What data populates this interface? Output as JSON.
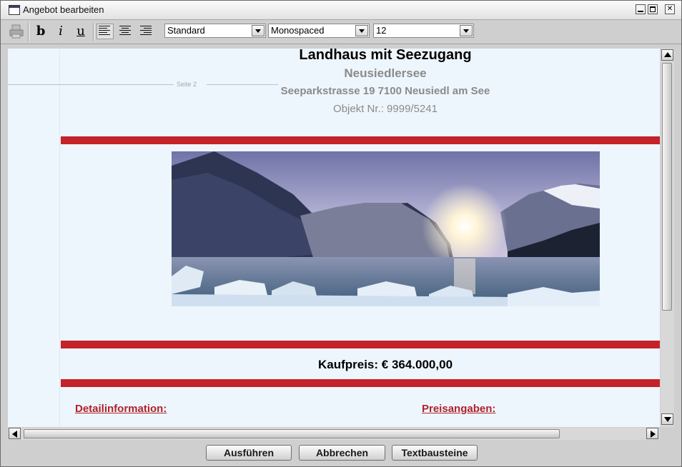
{
  "window": {
    "title": "Angebot bearbeiten"
  },
  "toolbar": {
    "print_icon": "printer-icon",
    "bold_label": "b",
    "italic_label": "i",
    "underline_label": "u",
    "style_select": "Standard",
    "font_select": "Monospaced",
    "size_select": "12"
  },
  "document": {
    "page_label": "Seite 2",
    "title": "Landhaus mit Seezugang",
    "subtitle": "Neusiedlersee",
    "address": "Seeparkstrasse 19 7100 Neusiedl am See",
    "object_number": "Objekt Nr.: 9999/5241",
    "price": "Kaufpreis: € 364.000,00",
    "section_details": "Detailinformation:",
    "section_prices": "Preisangaben: ",
    "image_subject": "mountain-lake-sunset-photo",
    "accent_color": "#c5222a"
  },
  "buttons": {
    "execute": "Ausführen",
    "cancel": "Abbrechen",
    "text_blocks": "Textbausteine"
  }
}
